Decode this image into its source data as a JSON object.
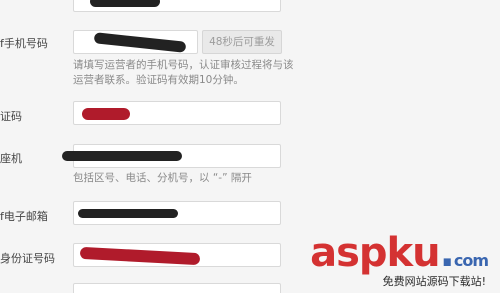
{
  "form": {
    "fields": [
      {
        "label": "",
        "value_masked": true
      },
      {
        "label": "f手机号码",
        "value_masked": true,
        "action": "48秒后可重发",
        "hint": [
          "请填写运营者的手机号码，认证审核过程将与该",
          "运营者联系。验证码有效期10分钟。"
        ]
      },
      {
        "label": "证码",
        "value_masked": true
      },
      {
        "label": "座机",
        "value_masked": true,
        "hint": [
          "包括区号、电话、分机号，以 “-” 隔开"
        ]
      },
      {
        "label": "f电子邮箱",
        "value_masked": true
      },
      {
        "label": "身份证号码",
        "value_masked": true
      }
    ]
  },
  "watermark": {
    "brand_main": "aspku",
    "brand_dot": ".",
    "brand_tld": "com",
    "subtitle": "免费网站源码下载站!"
  },
  "colors": {
    "page_bg": "#f5f5f5",
    "input_border": "#d9d9d9",
    "hint_text": "#8a8a8a",
    "brand_red": "#d43232",
    "brand_blue": "#3a66b0"
  }
}
